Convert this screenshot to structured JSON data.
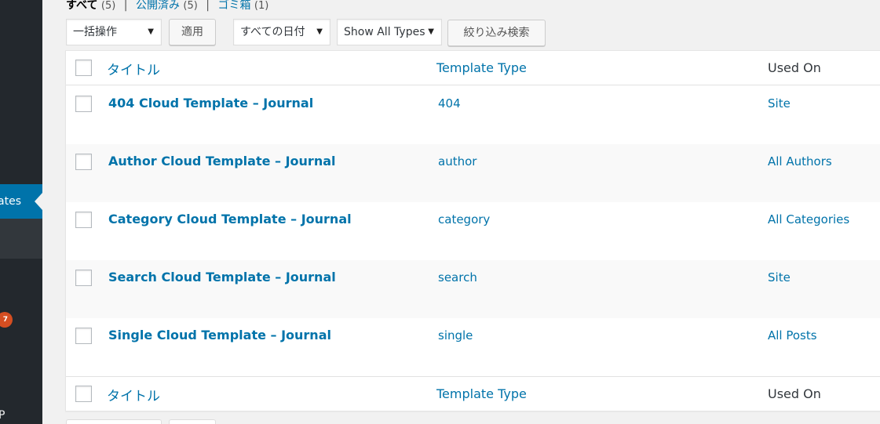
{
  "sidebar": {
    "active_item_label": "ates",
    "update_badge": "7",
    "bottom_item_fragment": "P"
  },
  "status_links": {
    "all": {
      "label": "すべて",
      "count": "(5)"
    },
    "published": {
      "label": "公開済み",
      "count": "(5)"
    },
    "trash": {
      "label": "ゴミ箱",
      "count": "(1)"
    },
    "separator": "|"
  },
  "toolbar": {
    "bulk_action": {
      "selected": "一括操作"
    },
    "apply_label": "適用",
    "date_filter": {
      "selected": "すべての日付"
    },
    "type_filter": {
      "selected": "Show All Types"
    },
    "filter_button_label": "絞り込み検索"
  },
  "table": {
    "columns": {
      "title": "タイトル",
      "template_type": "Template Type",
      "used_on": "Used On"
    },
    "rows": [
      {
        "title": "404 Cloud Template – Journal",
        "template_type": "404",
        "used_on": "Site"
      },
      {
        "title": "Author Cloud Template – Journal",
        "template_type": "author",
        "used_on": "All Authors"
      },
      {
        "title": "Category Cloud Template – Journal",
        "template_type": "category",
        "used_on": "All Categories"
      },
      {
        "title": "Search Cloud Template – Journal",
        "template_type": "search",
        "used_on": "Site"
      },
      {
        "title": "Single Cloud Template – Journal",
        "template_type": "single",
        "used_on": "All Posts"
      }
    ]
  },
  "icons": {
    "dropdown_caret": "▼"
  },
  "colors": {
    "link": "#0073aa",
    "sidebar_bg": "#23282d",
    "sidebar_active": "#0073aa",
    "badge": "#d54e21"
  }
}
